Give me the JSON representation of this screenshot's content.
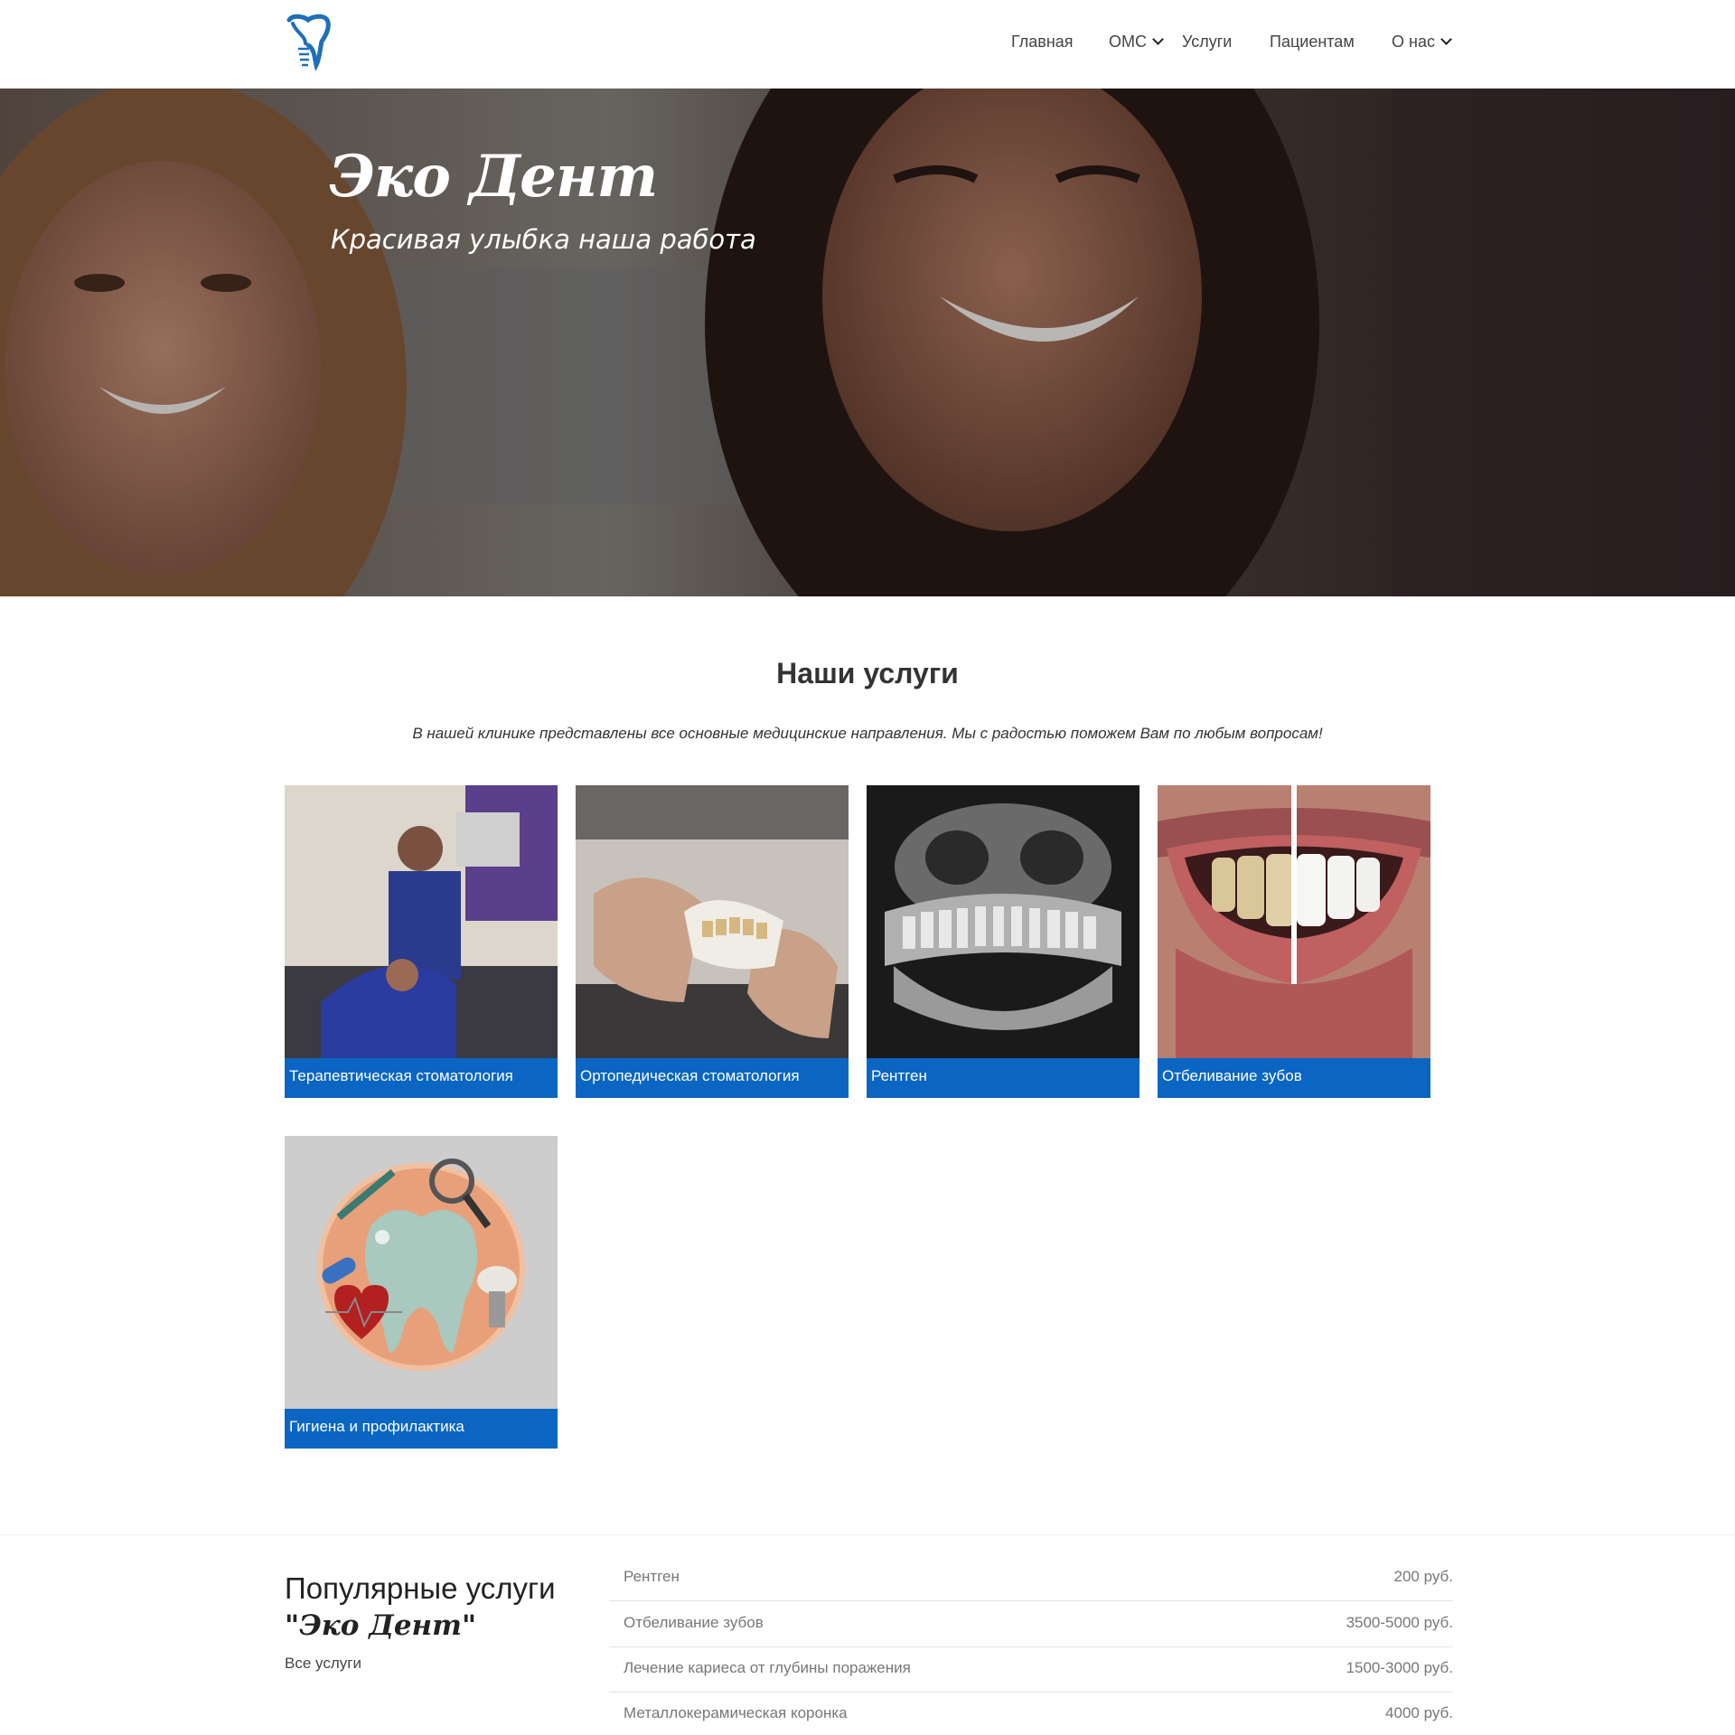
{
  "header": {
    "logo_icon": "tooth-implant-icon",
    "nav": [
      {
        "label": "Главная"
      },
      {
        "label": "ОМС",
        "has_dropdown": true
      },
      {
        "label": "Услуги"
      },
      {
        "label": "Пациентам"
      },
      {
        "label": "О нас",
        "has_dropdown": true
      }
    ]
  },
  "hero": {
    "title": "Эко Дент",
    "subtitle": "Красивая улыбка наша работа"
  },
  "services": {
    "title": "Наши услуги",
    "description": "В нашей клинике представлены все основные медицинские направления. Мы с радостью поможем Вам по любым вопросам!",
    "items": [
      {
        "label": "Терапевтическая стоматология"
      },
      {
        "label": "Ортопедическая стоматология"
      },
      {
        "label": "Рентген"
      },
      {
        "label": "Отбеливание зубов"
      },
      {
        "label": "Гигиена и профилактика"
      }
    ]
  },
  "popular": {
    "title": "Популярные услуги",
    "brand": "\"Эко Дент\"",
    "all_link": "Все услуги",
    "prices": [
      {
        "name": "Рентген",
        "price": "200 руб."
      },
      {
        "name": "Отбеливание зубов",
        "price": "3500-5000 руб."
      },
      {
        "name": "Лечение кариеса от глубины поражения",
        "price": "1500-3000 руб."
      },
      {
        "name": "Металлокерамическая коронка",
        "price": "4000 руб."
      }
    ]
  },
  "colors": {
    "accent": "#0a66c2",
    "logo": "#1e6fb8"
  }
}
